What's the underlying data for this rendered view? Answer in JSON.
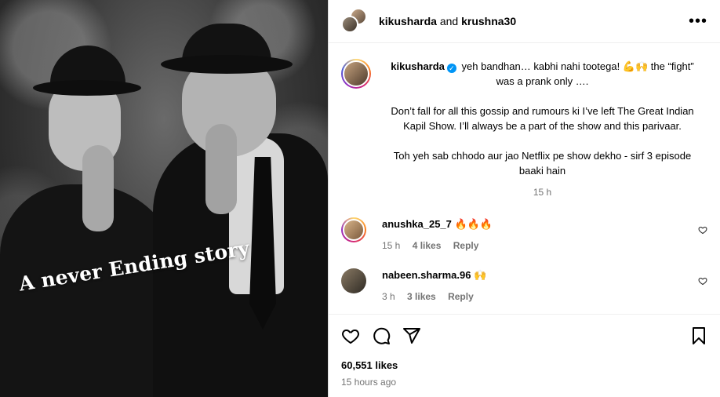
{
  "photo": {
    "caption": "A never Ending story"
  },
  "header": {
    "user1": "kikusharda",
    "joiner": "and",
    "user2": "krushna30",
    "more_label": "•••"
  },
  "caption": {
    "username": "kikusharda",
    "line1": "yeh bandhan… kabhi nahi tootega! 💪🙌 the “fight” was a prank only ….",
    "line2": "Don’t fall for all this gossip and rumours ki I’ve left The Great Indian Kapil Show. I’ll always be a part of the show and this parivaar.",
    "line3": "Toh yeh sab chhodo aur jao Netflix pe show dekho - sirf 3 episode baaki hain",
    "time": "15 h"
  },
  "comments": [
    {
      "username": "anushka_25_7",
      "text": "🔥🔥🔥",
      "time": "15 h",
      "likes": "4 likes",
      "reply": "Reply"
    },
    {
      "username": "nabeen.sharma.96",
      "text": "🙌",
      "time": "3 h",
      "likes": "3 likes",
      "reply": "Reply"
    }
  ],
  "footer": {
    "likes": "60,551 likes",
    "posted": "15 hours ago"
  }
}
